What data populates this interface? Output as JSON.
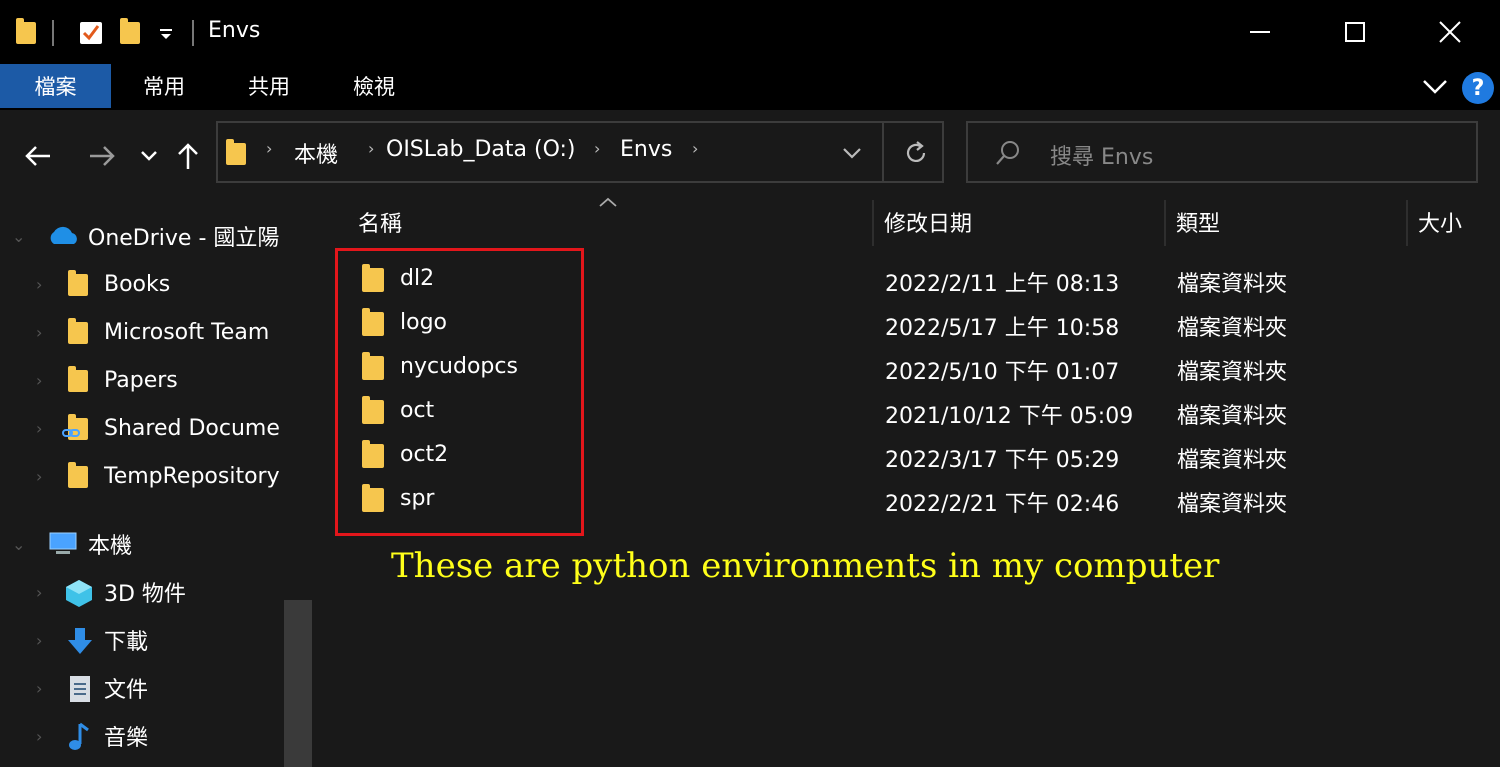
{
  "window": {
    "title": "Envs",
    "minimize_glyph": "—",
    "maximize_glyph": "☐",
    "close_glyph": "✕"
  },
  "ribbon": {
    "tabs": [
      {
        "label": "檔案",
        "active": true
      },
      {
        "label": "常用",
        "active": false
      },
      {
        "label": "共用",
        "active": false
      },
      {
        "label": "檢視",
        "active": false
      }
    ],
    "help_glyph": "?"
  },
  "address": {
    "crumbs": [
      "本機",
      "OISLab_Data (O:)",
      "Envs"
    ]
  },
  "search": {
    "placeholder": "搜尋 Envs"
  },
  "nav": {
    "onedrive": "OneDrive - 國立陽",
    "items": [
      {
        "label": "Books",
        "icon": "folder-icon"
      },
      {
        "label": "Microsoft Team",
        "icon": "folder-icon"
      },
      {
        "label": "Papers",
        "icon": "folder-icon"
      },
      {
        "label": "Shared Docume",
        "icon": "shared-folder-icon"
      },
      {
        "label": "TempRepository",
        "icon": "folder-icon"
      }
    ],
    "this_pc": "本機",
    "pc_items": [
      {
        "label": "3D 物件",
        "icon": "3d-objects-icon"
      },
      {
        "label": "下載",
        "icon": "download-icon"
      },
      {
        "label": "文件",
        "icon": "documents-icon"
      },
      {
        "label": "音樂",
        "icon": "music-icon"
      }
    ]
  },
  "columns": [
    "名稱",
    "修改日期",
    "類型",
    "大小"
  ],
  "files": [
    {
      "name": "dl2",
      "modified": "2022/2/11 上午 08:13",
      "type": "檔案資料夾"
    },
    {
      "name": "logo",
      "modified": "2022/5/17 上午 10:58",
      "type": "檔案資料夾"
    },
    {
      "name": "nycudopcs",
      "modified": "2022/5/10 下午 01:07",
      "type": "檔案資料夾"
    },
    {
      "name": "oct",
      "modified": "2021/10/12 下午 05:09",
      "type": "檔案資料夾"
    },
    {
      "name": "oct2",
      "modified": "2022/3/17 下午 05:29",
      "type": "檔案資料夾"
    },
    {
      "name": "spr",
      "modified": "2022/2/21 下午 02:46",
      "type": "檔案資料夾"
    }
  ],
  "annotation": "These are python environments in my computer",
  "colors": {
    "folder": "#f6c64e",
    "active_tab": "#1c5aa6",
    "highlight_border": "#e3161b",
    "annotation_text": "#ffff1a",
    "help_circle": "#1f7ae0"
  }
}
